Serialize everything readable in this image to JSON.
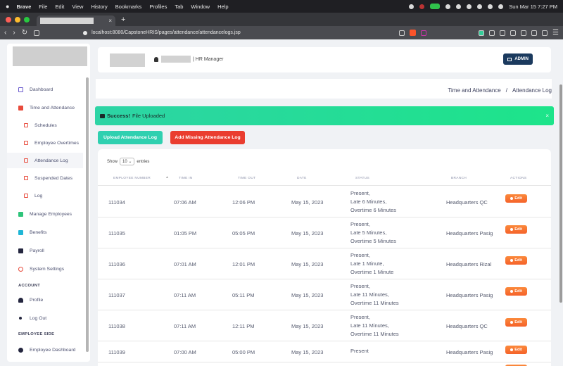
{
  "menubar": {
    "app": "Brave",
    "items": [
      "File",
      "Edit",
      "View",
      "History",
      "Bookmarks",
      "Profiles",
      "Tab",
      "Window",
      "Help"
    ],
    "datetime": "Sun Mar 15  7:27 PM"
  },
  "browser": {
    "url": "localhost:8080/CapstoneHRIS/pages/attendance/attendancelogs.jsp",
    "new_tab": "+",
    "tab_close": "×"
  },
  "sidebar": {
    "items": [
      {
        "label": "Dashboard",
        "icon": "monitor-icon"
      },
      {
        "label": "Time and Attendance",
        "icon": "calendar-icon"
      },
      {
        "label": "Schedules",
        "icon": "calendar-icon"
      },
      {
        "label": "Employee Overtimes",
        "icon": "calendar-icon"
      },
      {
        "label": "Attendance Log",
        "icon": "calendar-icon"
      },
      {
        "label": "Suspended Dates",
        "icon": "calendar-icon"
      },
      {
        "label": "Log",
        "icon": "calendar-icon"
      },
      {
        "label": "Manage Employees",
        "icon": "card-icon"
      },
      {
        "label": "Benefits",
        "icon": "benefits-icon"
      },
      {
        "label": "Payroll",
        "icon": "wallet-icon"
      },
      {
        "label": "System Settings",
        "icon": "globe-icon"
      },
      {
        "label": "Profile",
        "icon": "user-icon"
      },
      {
        "label": "Log Out",
        "icon": "logout-icon"
      },
      {
        "label": "Employee Dashboard",
        "icon": "user-circle-icon"
      }
    ],
    "section_account": "ACCOUNT",
    "section_employee": "EMPLOYEE SIDE"
  },
  "header": {
    "role": "| HR Manager",
    "admin_label": "ADMIN"
  },
  "breadcrumb": {
    "parent": "Time and Attendance",
    "separator": "/",
    "current": "Attendance Log"
  },
  "alert": {
    "strong": "Success!",
    "message": "File Uploaded",
    "close": "×"
  },
  "buttons": {
    "upload": "Upload Attendance Log",
    "missing": "Add Missing Attendance Log"
  },
  "table": {
    "show_label": "Show",
    "entries_value": "10",
    "entries_label": "entries",
    "columns": [
      "EMPLOYEE NUMBER",
      "TIME IN",
      "TIME OUT",
      "DATE",
      "STATUS",
      "BRANCH",
      "ACTIONS"
    ],
    "edit_label": "Edit",
    "rows": [
      {
        "emp": "111034",
        "in": "07:06 AM",
        "out": "12:06 PM",
        "date": "May 15, 2023",
        "status": [
          "Present,",
          "Late 6 Minutes,",
          "Overtime 6 Minutes"
        ],
        "branch": "Headquarters QC"
      },
      {
        "emp": "111035",
        "in": "01:05 PM",
        "out": "05:05 PM",
        "date": "May 15, 2023",
        "status": [
          "Present,",
          "Late 5 Minutes,",
          "Overtime 5 Minutes"
        ],
        "branch": "Headquarters Pasig"
      },
      {
        "emp": "111036",
        "in": "07:01 AM",
        "out": "12:01 PM",
        "date": "May 15, 2023",
        "status": [
          "Present,",
          "Late 1 Minute,",
          "Overtime 1 Minute"
        ],
        "branch": "Headquarters Rizal"
      },
      {
        "emp": "111037",
        "in": "07:11 AM",
        "out": "05:11 PM",
        "date": "May 15, 2023",
        "status": [
          "Present,",
          "Late 11 Minutes,",
          "Overtime 11 Minutes"
        ],
        "branch": "Headquarters Pasig"
      },
      {
        "emp": "111038",
        "in": "07:11 AM",
        "out": "12:11 PM",
        "date": "May 15, 2023",
        "status": [
          "Present,",
          "Late 11 Minutes,",
          "Overtime 11 Minutes"
        ],
        "branch": "Headquarters QC"
      },
      {
        "emp": "111039",
        "in": "07:00 AM",
        "out": "05:00 PM",
        "date": "May 15, 2023",
        "status": [
          "Present"
        ],
        "branch": "Headquarters Pasig"
      }
    ]
  },
  "colors": {
    "admin": "#1b3a5e",
    "upload": "#2fd0b0",
    "missing": "#ea3d2f",
    "edit": "#f5622a",
    "alert": "#1de48a"
  }
}
